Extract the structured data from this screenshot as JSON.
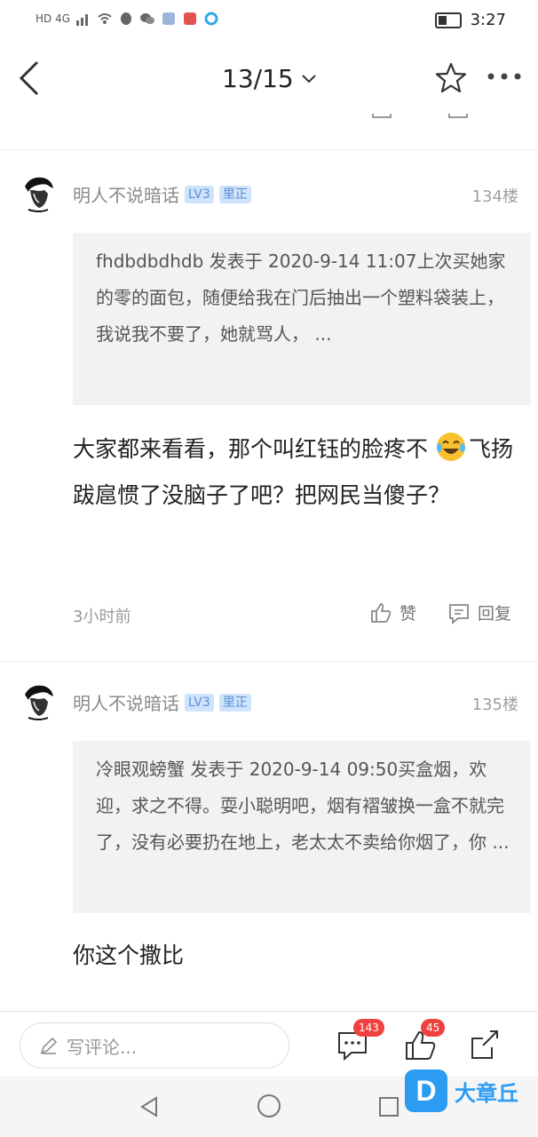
{
  "status_bar": {
    "network": "HD 4G",
    "time": "3:27"
  },
  "nav": {
    "page_indicator": "13/15"
  },
  "comments": [
    {
      "username": "明人不说暗话",
      "level": "LV3",
      "tag": "里正",
      "floor": "134楼",
      "quote": "fhdbdbdhdb 发表于 2020-9-14 11:07上次买她家的零的面包，随便给我在门后抽出一个塑料袋装上，我说我不要了，她就骂人， ...",
      "content_before_emoji": "大家都来看看，那个叫红钰的脸疼不",
      "content_after_emoji": "飞扬跋扈惯了没脑子了吧？把网民当傻子？",
      "time": "3小时前",
      "like_label": "赞",
      "reply_label": "回复"
    },
    {
      "username": "明人不说暗话",
      "level": "LV3",
      "tag": "里正",
      "floor": "135楼",
      "quote": "冷眼观螃蟹 发表于 2020-9-14 09:50买盒烟，欢迎，求之不得。耍小聪明吧，烟有褶皱换一盒不就完了，没有必要扔在地上，老太太不卖给你烟了，你 ...",
      "content": "你这个撒比"
    }
  ],
  "bottom_bar": {
    "input_placeholder": "写评论...",
    "comment_count": "143",
    "like_count": "45"
  },
  "watermark": {
    "logo_letter": "D",
    "text": "大章丘"
  },
  "colors": {
    "accent_blue": "#2b9cf2",
    "badge_red": "#f04141",
    "level_badge_bg": "#cfe3fb"
  }
}
